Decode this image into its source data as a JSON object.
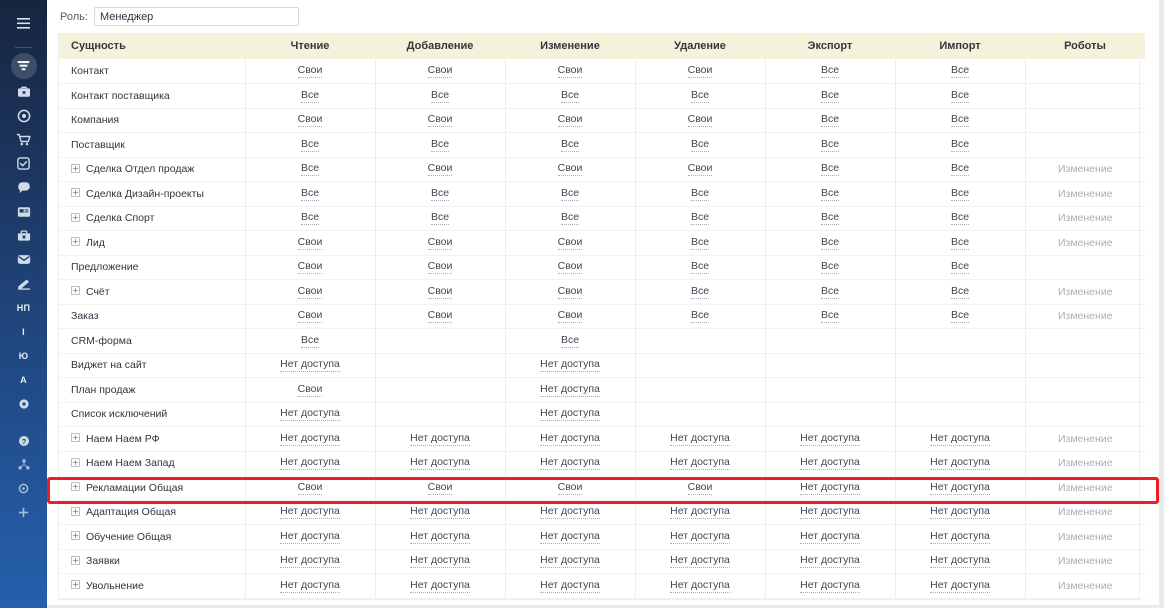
{
  "sidebar": {
    "items": [
      {
        "name": "menu-toggle",
        "icon": "hamburger-icon",
        "type": "icon"
      },
      {
        "name": "bitrix-logo",
        "icon": "funnel-logo-icon",
        "type": "icon",
        "active": true
      },
      {
        "name": "briefcase",
        "icon": "briefcase-icon",
        "type": "icon"
      },
      {
        "name": "target",
        "icon": "target-icon",
        "type": "icon"
      },
      {
        "name": "cart",
        "icon": "shopping-cart-icon",
        "type": "icon"
      },
      {
        "name": "tasks",
        "icon": "checkbox-square-icon",
        "type": "icon"
      },
      {
        "name": "chat",
        "icon": "chat-bubble-icon",
        "type": "icon"
      },
      {
        "name": "news",
        "icon": "news-icon",
        "type": "icon"
      },
      {
        "name": "toolbox",
        "icon": "toolbox-icon",
        "type": "icon"
      },
      {
        "name": "mail",
        "icon": "envelope-icon",
        "type": "icon"
      },
      {
        "name": "sign",
        "icon": "pen-sign-icon",
        "type": "icon"
      },
      {
        "name": "np-label",
        "label": "НП",
        "type": "text"
      },
      {
        "name": "i-label",
        "label": "I",
        "type": "text"
      },
      {
        "name": "yu-label",
        "label": "Ю",
        "type": "text"
      },
      {
        "name": "a-label",
        "label": "А",
        "type": "text"
      },
      {
        "name": "more-apps",
        "icon": "circle-dot-icon",
        "type": "icon"
      },
      {
        "name": "help",
        "icon": "question-circle-icon",
        "type": "icon"
      },
      {
        "name": "structure",
        "icon": "org-chart-icon",
        "type": "icon"
      },
      {
        "name": "settings",
        "icon": "gear-icon",
        "type": "icon"
      },
      {
        "name": "add",
        "icon": "plus-icon",
        "type": "icon"
      }
    ]
  },
  "rolebar": {
    "label": "Роль:",
    "value": "Менеджер",
    "placeholder": "Менеджер"
  },
  "table": {
    "columns": [
      "Сущность",
      "Чтение",
      "Добавление",
      "Изменение",
      "Удаление",
      "Экспорт",
      "Импорт",
      "Роботы"
    ],
    "highlighted_row": "Рекламации Общая",
    "highlight_color": "#ee1c25",
    "expander_glyph": "+",
    "rows": [
      {
        "entity": "Контакт",
        "expandable": false,
        "values": [
          "Свои",
          "Свои",
          "Свои",
          "Свои",
          "Все",
          "Все",
          ""
        ]
      },
      {
        "entity": "Контакт поставщика",
        "expandable": false,
        "values": [
          "Все",
          "Все",
          "Все",
          "Все",
          "Все",
          "Все",
          ""
        ]
      },
      {
        "entity": "Компания",
        "expandable": false,
        "values": [
          "Свои",
          "Свои",
          "Свои",
          "Свои",
          "Все",
          "Все",
          ""
        ]
      },
      {
        "entity": "Поставщик",
        "expandable": false,
        "values": [
          "Все",
          "Все",
          "Все",
          "Все",
          "Все",
          "Все",
          ""
        ]
      },
      {
        "entity": "Сделка Отдел продаж",
        "expandable": true,
        "values": [
          "Все",
          "Свои",
          "Свои",
          "Свои",
          "Все",
          "Все",
          "Изменение"
        ]
      },
      {
        "entity": "Сделка Дизайн-проекты",
        "expandable": true,
        "values": [
          "Все",
          "Все",
          "Все",
          "Все",
          "Все",
          "Все",
          "Изменение"
        ]
      },
      {
        "entity": "Сделка Спорт",
        "expandable": true,
        "values": [
          "Все",
          "Все",
          "Все",
          "Все",
          "Все",
          "Все",
          "Изменение"
        ]
      },
      {
        "entity": "Лид",
        "expandable": true,
        "values": [
          "Свои",
          "Свои",
          "Свои",
          "Все",
          "Все",
          "Все",
          "Изменение"
        ]
      },
      {
        "entity": "Предложение",
        "expandable": false,
        "values": [
          "Свои",
          "Свои",
          "Свои",
          "Все",
          "Все",
          "Все",
          ""
        ]
      },
      {
        "entity": "Счёт",
        "expandable": true,
        "values": [
          "Свои",
          "Свои",
          "Свои",
          "Все",
          "Все",
          "Все",
          "Изменение"
        ]
      },
      {
        "entity": "Заказ",
        "expandable": false,
        "values": [
          "Свои",
          "Свои",
          "Свои",
          "Все",
          "Все",
          "Все",
          "Изменение"
        ]
      },
      {
        "entity": "CRM-форма",
        "expandable": false,
        "values": [
          "Все",
          "",
          "Все",
          "",
          "",
          "",
          ""
        ]
      },
      {
        "entity": "Виджет на сайт",
        "expandable": false,
        "values": [
          "Нет доступа",
          "",
          "Нет доступа",
          "",
          "",
          "",
          ""
        ]
      },
      {
        "entity": "План продаж",
        "expandable": false,
        "values": [
          "Свои",
          "",
          "Нет доступа",
          "",
          "",
          "",
          ""
        ]
      },
      {
        "entity": "Список исключений",
        "expandable": false,
        "values": [
          "Нет доступа",
          "",
          "Нет доступа",
          "",
          "",
          "",
          ""
        ]
      },
      {
        "entity": "Наем Наем РФ",
        "expandable": true,
        "values": [
          "Нет доступа",
          "Нет доступа",
          "Нет доступа",
          "Нет доступа",
          "Нет доступа",
          "Нет доступа",
          "Изменение"
        ]
      },
      {
        "entity": "Наем Наем Запад",
        "expandable": true,
        "values": [
          "Нет доступа",
          "Нет доступа",
          "Нет доступа",
          "Нет доступа",
          "Нет доступа",
          "Нет доступа",
          "Изменение"
        ]
      },
      {
        "entity": "Рекламации Общая",
        "expandable": true,
        "values": [
          "Свои",
          "Свои",
          "Свои",
          "Свои",
          "Нет доступа",
          "Нет доступа",
          "Изменение"
        ]
      },
      {
        "entity": "Адаптация Общая",
        "expandable": true,
        "values": [
          "Нет доступа",
          "Нет доступа",
          "Нет доступа",
          "Нет доступа",
          "Нет доступа",
          "Нет доступа",
          "Изменение"
        ]
      },
      {
        "entity": "Обучение Общая",
        "expandable": true,
        "values": [
          "Нет доступа",
          "Нет доступа",
          "Нет доступа",
          "Нет доступа",
          "Нет доступа",
          "Нет доступа",
          "Изменение"
        ]
      },
      {
        "entity": "Заявки",
        "expandable": true,
        "values": [
          "Нет доступа",
          "Нет доступа",
          "Нет доступа",
          "Нет доступа",
          "Нет доступа",
          "Нет доступа",
          "Изменение"
        ]
      },
      {
        "entity": "Увольнение",
        "expandable": true,
        "values": [
          "Нет доступа",
          "Нет доступа",
          "Нет доступа",
          "Нет доступа",
          "Нет доступа",
          "Нет доступа",
          "Изменение"
        ]
      }
    ]
  }
}
